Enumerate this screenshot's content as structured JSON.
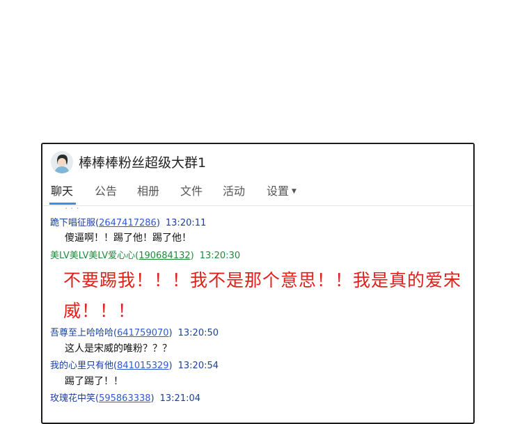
{
  "group": {
    "title": "棒棒棒粉丝超级大群1",
    "avatar_icon": "user-avatar"
  },
  "tabs": [
    {
      "label": "聊天",
      "active": true
    },
    {
      "label": "公告",
      "active": false
    },
    {
      "label": "相册",
      "active": false
    },
    {
      "label": "文件",
      "active": false
    },
    {
      "label": "活动",
      "active": false
    },
    {
      "label": "设置",
      "active": false,
      "has_dropdown": true
    }
  ],
  "colors": {
    "accent": "#3a8ee6",
    "sender_blue": "#1a3f9c",
    "sender_green": "#1f8a3a",
    "highlight_red": "#e0201b"
  },
  "messages": [
    {
      "name": "跪下唱征服",
      "qq": "2647417286",
      "time": "13:20:11",
      "text": "傻逼啊！！踢了他！踢了他！"
    },
    {
      "name": "美LV美LV美LV爱心心",
      "qq": "190684132",
      "time": "13:20:30",
      "text": "不要踢我！！！我不是那个意思！！我是真的爱宋威！！！"
    },
    {
      "name": "吾尊至上哈哈哈",
      "qq": "641759070",
      "time": "13:20:50",
      "text": "这人是宋威的唯粉？？？"
    },
    {
      "name": "我的心里只有他",
      "qq": "841015329",
      "time": "13:20:54",
      "text": "踢了踢了！！"
    },
    {
      "name": "玫瑰花中笑",
      "qq": "595863338",
      "time": "13:21:04",
      "text": ""
    }
  ]
}
